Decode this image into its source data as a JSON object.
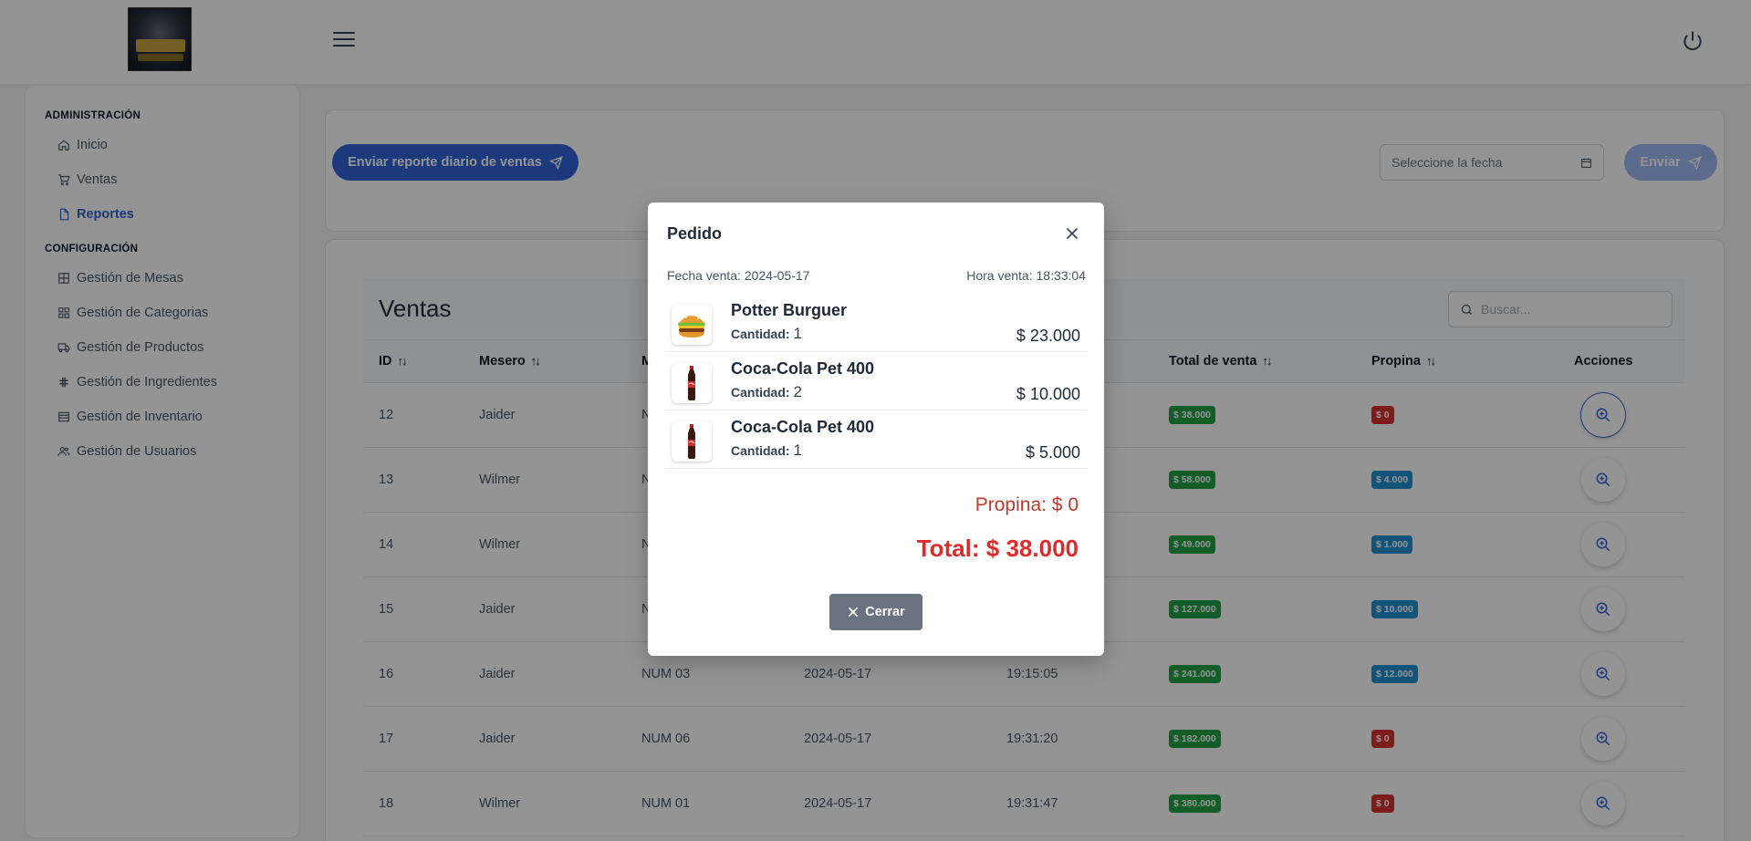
{
  "topbar": {
    "logo_alt": "logo",
    "menu_icon": "hamburger-icon",
    "power_icon": "power-icon"
  },
  "sidebar": {
    "sections": [
      {
        "heading": "ADMINISTRACIÓN",
        "items": [
          {
            "label": "Inicio",
            "icon": "home-icon",
            "active": false
          },
          {
            "label": "Ventas",
            "icon": "cart-icon",
            "active": false
          },
          {
            "label": "Reportes",
            "icon": "document-icon",
            "active": true
          }
        ]
      },
      {
        "heading": "CONFIGURACIÓN",
        "items": [
          {
            "label": "Gestión de Mesas",
            "icon": "table-icon",
            "active": false
          },
          {
            "label": "Gestión de Categorias",
            "icon": "grid-icon",
            "active": false
          },
          {
            "label": "Gestión de Productos",
            "icon": "truck-icon",
            "active": false
          },
          {
            "label": "Gestión de Ingredientes",
            "icon": "hash-icon",
            "active": false
          },
          {
            "label": "Gestión de Inventario",
            "icon": "list-icon",
            "active": false
          },
          {
            "label": "Gestión de Usuarios",
            "icon": "users-icon",
            "active": false
          }
        ]
      }
    ]
  },
  "report": {
    "send_report_label": "Enviar reporte diario de ventas",
    "date_placeholder": "Seleccione la fecha",
    "send_label": "Enviar"
  },
  "sales": {
    "title": "Ventas",
    "search_placeholder": "Buscar...",
    "columns": [
      "ID",
      "Mesero",
      "M",
      "",
      "",
      "Total de venta",
      "Propina",
      "Acciones"
    ],
    "rows": [
      {
        "id": "12",
        "mesero": "Jaider",
        "mesa": "N",
        "fecha": "",
        "hora": "",
        "total": "$ 38.000",
        "propina": "$ 0",
        "propina_color": "red",
        "focused": true
      },
      {
        "id": "13",
        "mesero": "Wilmer",
        "mesa": "N",
        "fecha": "",
        "hora": "",
        "total": "$ 58.000",
        "propina": "$ 4.000",
        "propina_color": "blue",
        "focused": false
      },
      {
        "id": "14",
        "mesero": "Wilmer",
        "mesa": "N",
        "fecha": "",
        "hora": "",
        "total": "$ 49.000",
        "propina": "$ 1.000",
        "propina_color": "blue",
        "focused": false
      },
      {
        "id": "15",
        "mesero": "Jaider",
        "mesa": "N",
        "fecha": "",
        "hora": "",
        "total": "$ 127.000",
        "propina": "$ 10.000",
        "propina_color": "blue",
        "focused": false
      },
      {
        "id": "16",
        "mesero": "Jaider",
        "mesa": "NUM 03",
        "fecha": "2024-05-17",
        "hora": "19:15:05",
        "total": "$ 241.000",
        "propina": "$ 12.000",
        "propina_color": "blue",
        "focused": false
      },
      {
        "id": "17",
        "mesero": "Jaider",
        "mesa": "NUM 06",
        "fecha": "2024-05-17",
        "hora": "19:31:20",
        "total": "$ 182.000",
        "propina": "$ 0",
        "propina_color": "red",
        "focused": false
      },
      {
        "id": "18",
        "mesero": "Wilmer",
        "mesa": "NUM 01",
        "fecha": "2024-05-17",
        "hora": "19:31:47",
        "total": "$ 380.000",
        "propina": "$ 0",
        "propina_color": "red",
        "focused": false
      }
    ]
  },
  "modal": {
    "title": "Pedido",
    "fecha": "Fecha venta: 2024-05-17",
    "hora": "Hora venta: 18:33:04",
    "qty_label": "Cantidad:",
    "items": [
      {
        "name": "Potter Burguer",
        "qty": "1",
        "price": "$ 23.000",
        "icon": "burger-icon"
      },
      {
        "name": "Coca-Cola Pet 400",
        "qty": "2",
        "price": "$ 10.000",
        "icon": "soda-bottle-icon"
      },
      {
        "name": "Coca-Cola Pet 400",
        "qty": "1",
        "price": "$ 5.000",
        "icon": "soda-bottle-icon"
      }
    ],
    "tip": "Propina: $ 0",
    "total": "Total: $ 38.000",
    "close_label": "Cerrar"
  },
  "colors": {
    "primary": "#2f63d6",
    "success": "#22a047",
    "info": "#1f8fd0",
    "danger": "#d93030",
    "total_red": "#e02b2b"
  }
}
